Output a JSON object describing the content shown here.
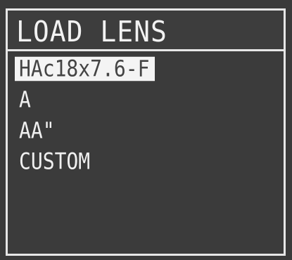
{
  "title": "LOAD LENS",
  "lens_list": {
    "items": [
      {
        "label": "HAc18x7.6-F",
        "selected": true
      },
      {
        "label": "A",
        "selected": false
      },
      {
        "label": "AA\"",
        "selected": false
      },
      {
        "label": "CUSTOM",
        "selected": false
      }
    ]
  },
  "colors": {
    "background": "#3b3b3b",
    "text": "#f0f0f0",
    "highlight_bg": "#f4f4f4",
    "highlight_text": "#444444"
  }
}
